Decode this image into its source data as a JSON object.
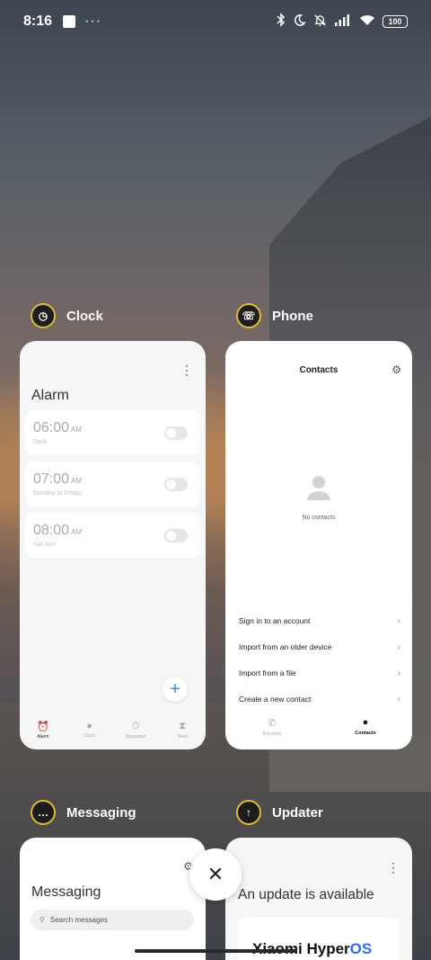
{
  "status_bar": {
    "time": "8:16",
    "dots": "···",
    "icons": [
      "bluetooth-icon",
      "moon-icon",
      "bell-off-icon",
      "signal-icon",
      "wifi-icon"
    ],
    "battery": "100"
  },
  "apps": {
    "clock": {
      "name": "Clock",
      "title": "Alarm",
      "alarms": [
        {
          "time": "06:00",
          "ampm": "AM",
          "sub": "Daily"
        },
        {
          "time": "07:00",
          "ampm": "AM",
          "sub": "Monday to Friday"
        },
        {
          "time": "08:00",
          "ampm": "AM",
          "sub": "Sat Sun"
        }
      ],
      "tabs": [
        "Alarm",
        "Clock",
        "Stopwatch",
        "Timer"
      ],
      "add_label": "+"
    },
    "phone": {
      "name": "Phone",
      "title": "Contacts",
      "empty_text": "No contacts",
      "actions": [
        "Sign in to an account",
        "Import from an older device",
        "Import from a file",
        "Create a new contact"
      ],
      "tabs": [
        "Recents",
        "Contacts"
      ]
    },
    "messaging": {
      "name": "Messaging",
      "title": "Messaging",
      "search_placeholder": "Search messages"
    },
    "updater": {
      "name": "Updater",
      "title": "An update is available",
      "brand_prefix": "Xiaomi Hyper",
      "brand_suffix": "OS"
    }
  },
  "close_label": "✕",
  "colors": {
    "accent_gold": "#e2b933",
    "fab_blue": "#2d8cff",
    "os_blue": "#2f6bff"
  }
}
